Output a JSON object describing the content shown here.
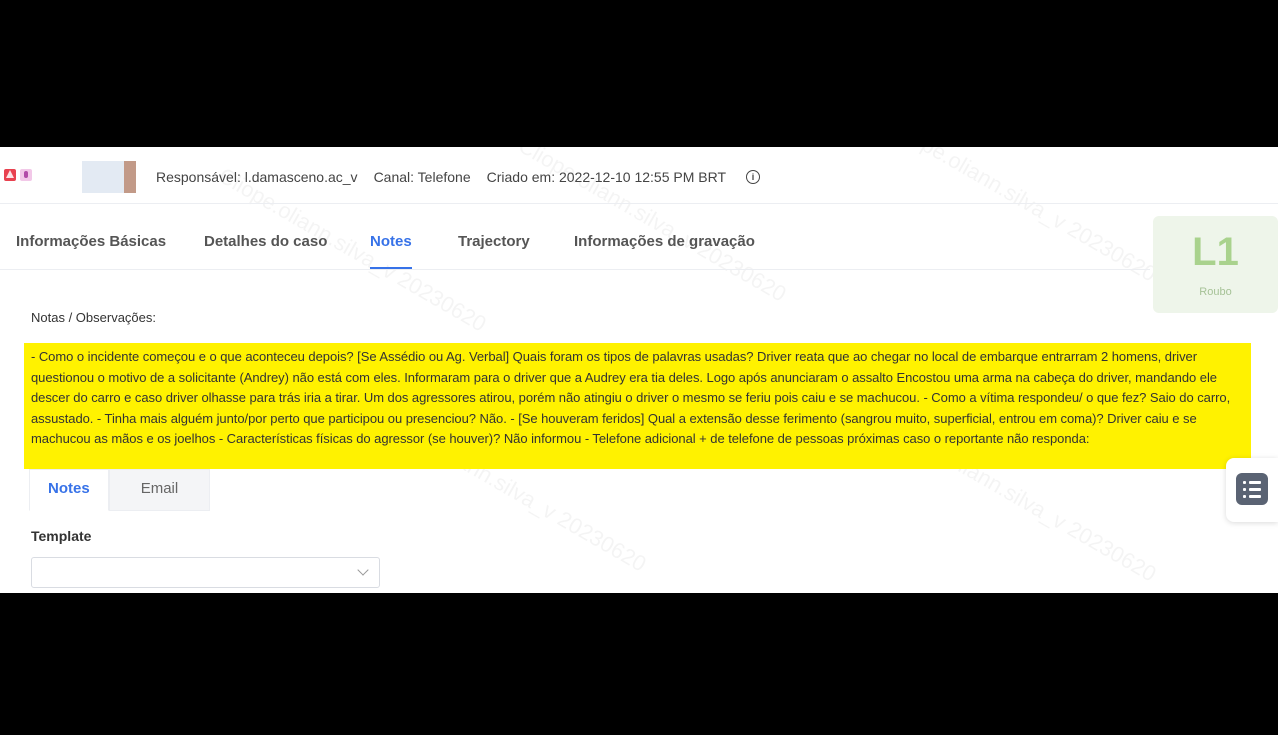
{
  "header": {
    "responsavel": "Responsável: l.damasceno.ac_v",
    "canal": "Canal: Telefone",
    "criado": "Criado em: 2022-12-10 12:55 PM BRT"
  },
  "tabs": [
    {
      "label": "Informações Básicas"
    },
    {
      "label": "Detalhes do caso"
    },
    {
      "label": "Notes"
    },
    {
      "label": "Trajectory"
    },
    {
      "label": "Informações de gravação"
    }
  ],
  "level": {
    "code": "L1",
    "label": "Roubo"
  },
  "notes": {
    "section_label": "Notas / Observações:",
    "text": "- Como o incidente começou e o que aconteceu depois? [Se Assédio ou Ag. Verbal] Quais foram os tipos de palavras usadas? Driver reata que ao chegar no local de embarque entrarram 2 homens, driver questionou o motivo de a solicitante (Andrey) não está com eles. Informaram para o driver que a Audrey era tia deles. Logo após anunciaram o assalto Encostou uma arma na cabeça do driver, mandando ele descer do carro e caso driver olhasse para trás iria a tirar. Um dos agressores atirou, porém não atingiu o driver o mesmo se feriu pois caiu e se machucou. - Como a vítima respondeu/ o que fez? Saio do carro, assustado. - Tinha mais alguém junto/por perto que participou ou presenciou? Não. - [Se houveram feridos] Qual a extensão desse ferimento (sangrou muito, superficial, entrou em coma)? Driver caiu e se machucou as mãos e os joelhos - Características físicas do agressor (se houver)? Não informou - Telefone adicional + de telefone de pessoas próximas caso o reportante não responda:"
  },
  "subtabs": [
    {
      "label": "Notes"
    },
    {
      "label": "Email"
    }
  ],
  "template": {
    "label": "Template",
    "value": ""
  }
}
